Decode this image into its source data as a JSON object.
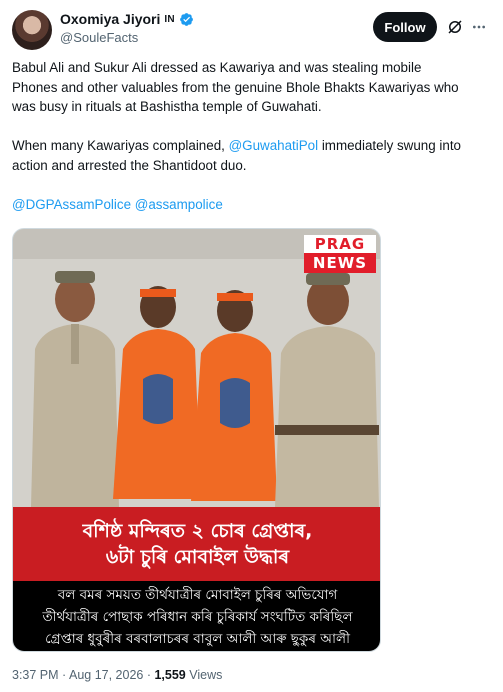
{
  "author": {
    "display_name": "Oxomiya Jiyori",
    "country_tag": "IN",
    "handle": "@SouleFacts"
  },
  "actions": {
    "follow_label": "Follow"
  },
  "tweet": {
    "line1": "Babul Ali and Sukur Ali dressed as Kawariya and was stealing mobile",
    "line2": "Phones and other valuables from the genuine Bhole Bhakts Kawariyas who",
    "line3": "was busy in rituals at Bashistha temple of Guwahati.",
    "line4_pre": "When many Kawariyas complained, ",
    "line4_mention": "@GuwahatiPol",
    "line4_post": " immediately swung into",
    "line5": "action and arrested the Shantidoot duo.",
    "mention1": "@DGPAssamPolice",
    "mention2": "@assampolice"
  },
  "media": {
    "logo_top": "PRAG",
    "logo_bottom": "NEWS",
    "headline_line1": "বশিষ্ঠ মন্দিৰত ২ চোৰ গ্ৰেপ্তাৰ,",
    "headline_line2": "৬টা চুৰি মোবাইল উদ্ধাৰ",
    "sub_line1": "বল বমৰ সময়ত তীৰ্থযাত্ৰীৰ মোবাইল চুৰিৰ অভিযোগ",
    "sub_line2": "তীৰ্থযাত্ৰীৰ পোছাক পৰিধান কৰি চুৰিকাৰ্য সংঘটিত কৰিছিল",
    "sub_line3": "গ্ৰেপ্তাৰ ধুবুৰীৰ বৰবালাচৰৰ বাবুল আলী আৰু ছুকুৰ আলী"
  },
  "meta": {
    "time": "3:37 PM",
    "separator": " · ",
    "date": "Aug 17, 2026",
    "views_count": "1,559",
    "views_label": " Views"
  },
  "colors": {
    "accent": "#1d9bf0",
    "follow_bg": "#0f1419",
    "headline_red": "#c91d22",
    "prag_red": "#e11d2a"
  },
  "icons": [
    "verified-badge-icon",
    "grok-icon",
    "more-icon"
  ]
}
